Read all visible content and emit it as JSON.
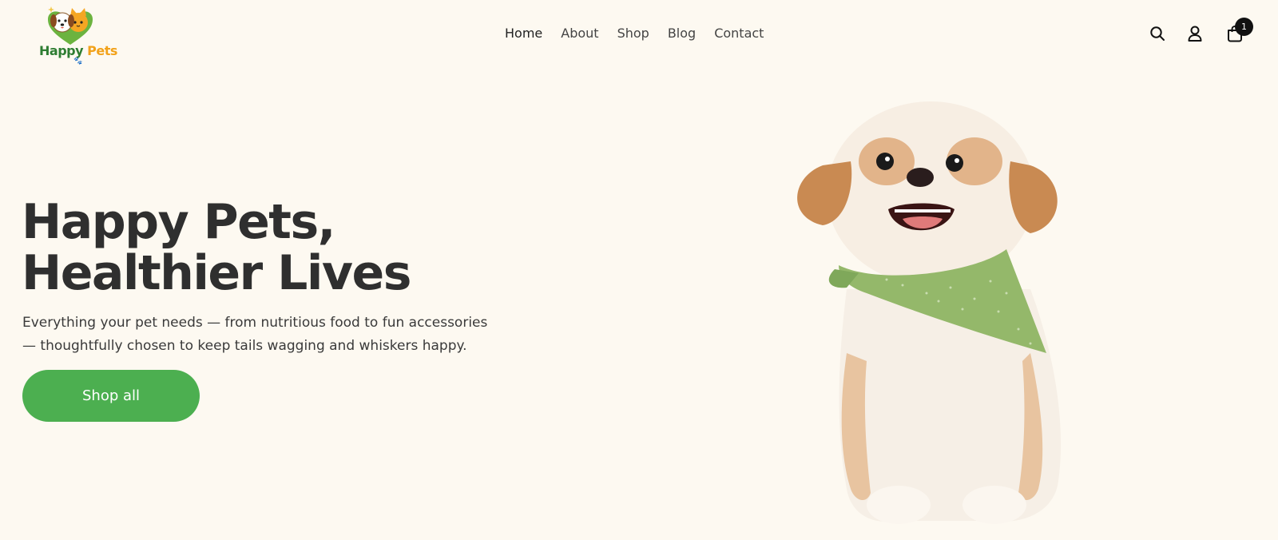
{
  "brand": {
    "word1": "Happy",
    "word2": "Pets"
  },
  "nav": {
    "items": [
      {
        "label": "Home"
      },
      {
        "label": "About"
      },
      {
        "label": "Shop"
      },
      {
        "label": "Blog"
      },
      {
        "label": "Contact"
      }
    ],
    "active": "Home"
  },
  "header_icons": {
    "search": "search-icon",
    "account": "user-icon",
    "cart": "shopping-bag-icon"
  },
  "cart": {
    "count": "1"
  },
  "hero": {
    "title_line1": "Happy Pets,",
    "title_line2": "Healthier Lives",
    "description": "Everything your pet needs — from nutritious food to fun accessories — thoughtfully chosen to keep tails wagging and whiskers happy.",
    "cta_label": "Shop all"
  },
  "colors": {
    "background": "#fdf9f1",
    "accent_green": "#4caf50",
    "brand_green": "#2e7d32",
    "brand_orange": "#f2a21b",
    "text_dark": "#2f2f2f"
  }
}
